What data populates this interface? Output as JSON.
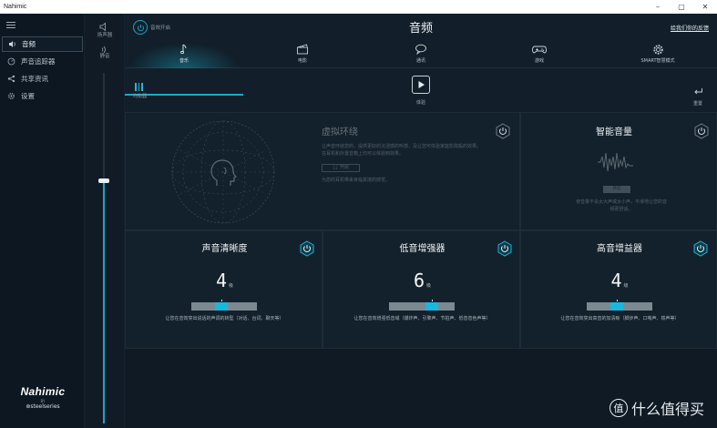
{
  "window": {
    "title": "Nahimic",
    "controls": [
      "–",
      "▢",
      "✕"
    ]
  },
  "sidebar": {
    "items": [
      {
        "label": "音频",
        "icon": "audio-icon",
        "active": true
      },
      {
        "label": "声音追踪器",
        "icon": "sound-tracker-icon",
        "active": false
      },
      {
        "label": "共享资讯",
        "icon": "share-icon",
        "active": false
      },
      {
        "label": "设置",
        "icon": "settings-icon",
        "active": false
      }
    ],
    "logo": {
      "brand": "Nahimic",
      "by": "BY",
      "partner": "⊛steelseries"
    }
  },
  "volume": {
    "speaker_label": "扬声器",
    "mute_label": "静音",
    "level": 0.58
  },
  "header": {
    "effect_label": "音效开启",
    "title": "音频",
    "feedback": "给我们你的反馈"
  },
  "tabs": [
    {
      "label": "音乐",
      "icon": "music-note-icon",
      "active": true
    },
    {
      "label": "电影",
      "icon": "clapperboard-icon",
      "active": false
    },
    {
      "label": "通讯",
      "icon": "chat-bubble-icon",
      "active": false
    },
    {
      "label": "游戏",
      "icon": "gamepad-icon",
      "active": false
    },
    {
      "label": "SMART智慧模式",
      "icon": "smart-gear-icon",
      "active": false
    }
  ],
  "toolbar": {
    "eq_label": "均衡器",
    "play_label": "体验",
    "reset_label": "重置"
  },
  "virtual_surround": {
    "title": "虚拟环绕",
    "desc1": "让声音环绕您的，提供更好的沉浸感的听感，及让您可体验家庭影院般的效果。",
    "desc2": "在耳机和外置音箱上均可以体验到效果。",
    "button": "开启",
    "desc3": "为您的耳机带来身临其境的感觉。"
  },
  "smart_volume": {
    "title": "智能音量",
    "button": "开启",
    "desc": "使音量不会太大声或太小声，平滑地让您的音频更舒适。"
  },
  "enhancers": [
    {
      "title": "声音清晰度",
      "value": "4",
      "unit": "级",
      "level": 0.4,
      "desc": "让您在音效突出说话的声调的转型（对话、台词、聊天等）"
    },
    {
      "title": "低音增强器",
      "value": "6",
      "unit": "级",
      "level": 0.6,
      "desc": "让您在音效增强低音域（爆炸声、引擎声、节拍声、低音音色声等）"
    },
    {
      "title": "高音增益器",
      "value": "4",
      "unit": "级",
      "level": 0.4,
      "desc": "让您在音效突出高音的加清晰（脚步声、口哨声、铁声等）"
    }
  ],
  "watermark": {
    "badge": "值",
    "text": "什么值得买"
  },
  "colors": {
    "accent": "#1ab7dd",
    "background": "#121f2a"
  }
}
